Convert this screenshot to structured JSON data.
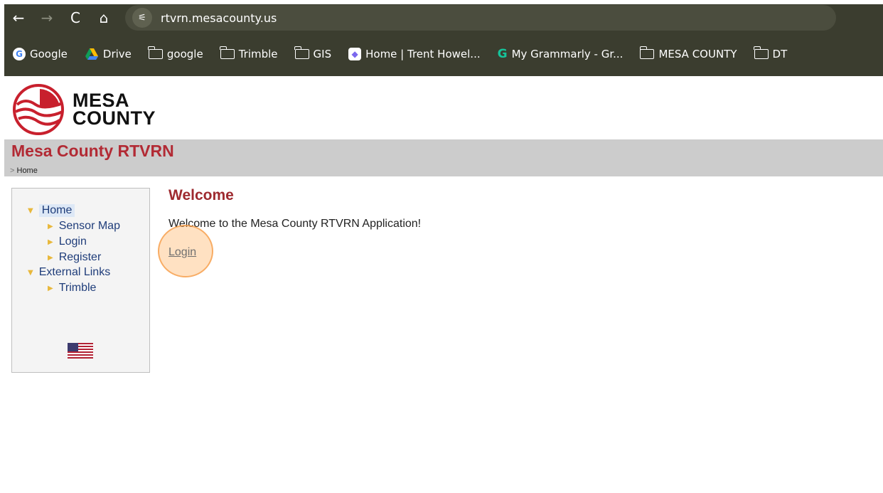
{
  "browser": {
    "url": "rtvrn.mesacounty.us",
    "nav_icons": {
      "back": "←",
      "forward": "→",
      "reload": "C",
      "home": "⌂",
      "site_info": "⚟"
    },
    "bookmarks": [
      {
        "label": "Google",
        "icon": "google-icon"
      },
      {
        "label": "Drive",
        "icon": "drive-icon"
      },
      {
        "label": "google",
        "icon": "folder-icon"
      },
      {
        "label": "Trimble",
        "icon": "folder-icon"
      },
      {
        "label": "GIS",
        "icon": "folder-icon"
      },
      {
        "label": "Home | Trent Howel...",
        "icon": "clickup-icon"
      },
      {
        "label": "My Grammarly - Gr...",
        "icon": "grammarly-icon"
      },
      {
        "label": "MESA COUNTY",
        "icon": "folder-icon"
      },
      {
        "label": "DT",
        "icon": "folder-icon"
      }
    ]
  },
  "logo": {
    "line1": "MESA",
    "line2": "COUNTY"
  },
  "header": {
    "title": "Mesa County RTVRN",
    "breadcrumb_sep": ">",
    "breadcrumb": "Home"
  },
  "sidebar": {
    "home": "Home",
    "sensor_map": "Sensor Map",
    "login": "Login",
    "register": "Register",
    "external_links": "External Links",
    "trimble": "Trimble"
  },
  "content": {
    "heading": "Welcome",
    "text": "Welcome to the Mesa County RTVRN Application!",
    "login_link": "Login"
  },
  "colors": {
    "chrome": "#3b3d2f",
    "title_red": "#b22a34",
    "heading_red": "#9e2a2f",
    "link_blue": "#1f3d7a",
    "title_bar": "#cccccc"
  }
}
